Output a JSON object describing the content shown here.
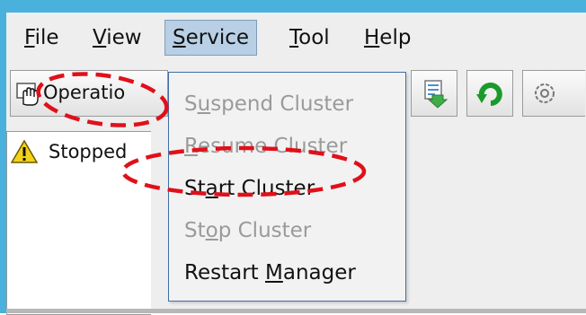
{
  "menubar": {
    "items": [
      {
        "label_pre": "",
        "mnemonic": "F",
        "label_post": "ile"
      },
      {
        "label_pre": "",
        "mnemonic": "V",
        "label_post": "iew"
      },
      {
        "label_pre": "",
        "mnemonic": "S",
        "label_post": "ervice"
      },
      {
        "label_pre": "",
        "mnemonic": "T",
        "label_post": "ool"
      },
      {
        "label_pre": "",
        "mnemonic": "H",
        "label_post": "elp"
      }
    ],
    "active_index": 2
  },
  "toolbar": {
    "operation_label": "Operatio",
    "icons": [
      "export-icon",
      "refresh-icon",
      "settings-icon"
    ]
  },
  "tree": {
    "status_label": "Stopped",
    "status_icon": "warning-icon"
  },
  "service_menu": {
    "items": [
      {
        "pre": "S",
        "mnemonic": "u",
        "post": "spend Cluster",
        "enabled": false
      },
      {
        "pre": "",
        "mnemonic": "R",
        "post": "esume Cluster",
        "enabled": false
      },
      {
        "pre": "St",
        "mnemonic": "a",
        "post": "rt Cluster",
        "enabled": true
      },
      {
        "pre": "St",
        "mnemonic": "o",
        "post": "p Cluster",
        "enabled": false
      },
      {
        "pre": "Restart ",
        "mnemonic": "M",
        "post": "anager",
        "enabled": true
      }
    ]
  },
  "colors": {
    "frame_border": "#4ab0dc",
    "menu_highlight": "#b8cfe5",
    "annotation_red": "#e0101a",
    "disabled_text": "#9a9a9a"
  }
}
